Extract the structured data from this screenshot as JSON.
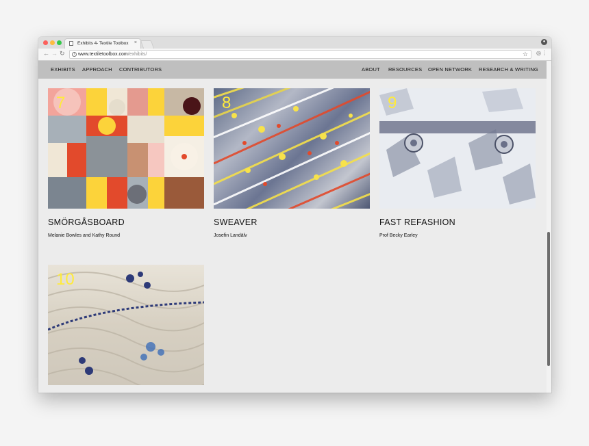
{
  "browser": {
    "tab_title": "Exhibits 4- Textile Toolbox",
    "tab_close": "×",
    "url_domain": "www.textiletoolbox.com",
    "url_path": "/exhibits/"
  },
  "nav": {
    "left": [
      "EXHIBITS",
      "APPROACH",
      "CONTRIBUTORS"
    ],
    "right": [
      "ABOUT",
      "RESOURCES",
      "OPEN NETWORK",
      "RESEARCH & WRITING"
    ]
  },
  "exhibits": [
    {
      "number": "7",
      "title": "SMÖRGÅSBOARD",
      "author": "Melanie Bowles and Kathy Round"
    },
    {
      "number": "8",
      "title": "SWEAVER",
      "author": "Josefin Landälv"
    },
    {
      "number": "9",
      "title": "FAST REFASHION",
      "author": "Prof Becky Earley"
    },
    {
      "number": "10",
      "title": "",
      "author": ""
    }
  ],
  "icons": {
    "back": "back-arrow-icon",
    "forward": "forward-arrow-icon",
    "reload": "reload-icon",
    "info": "info-icon",
    "star": "star-icon",
    "profile": "profile-icon",
    "menu": "menu-dots-icon"
  },
  "colors": {
    "nav_bg": "#bfbfbf",
    "number_color": "#ffeb3b",
    "page_bg": "#ececec"
  }
}
